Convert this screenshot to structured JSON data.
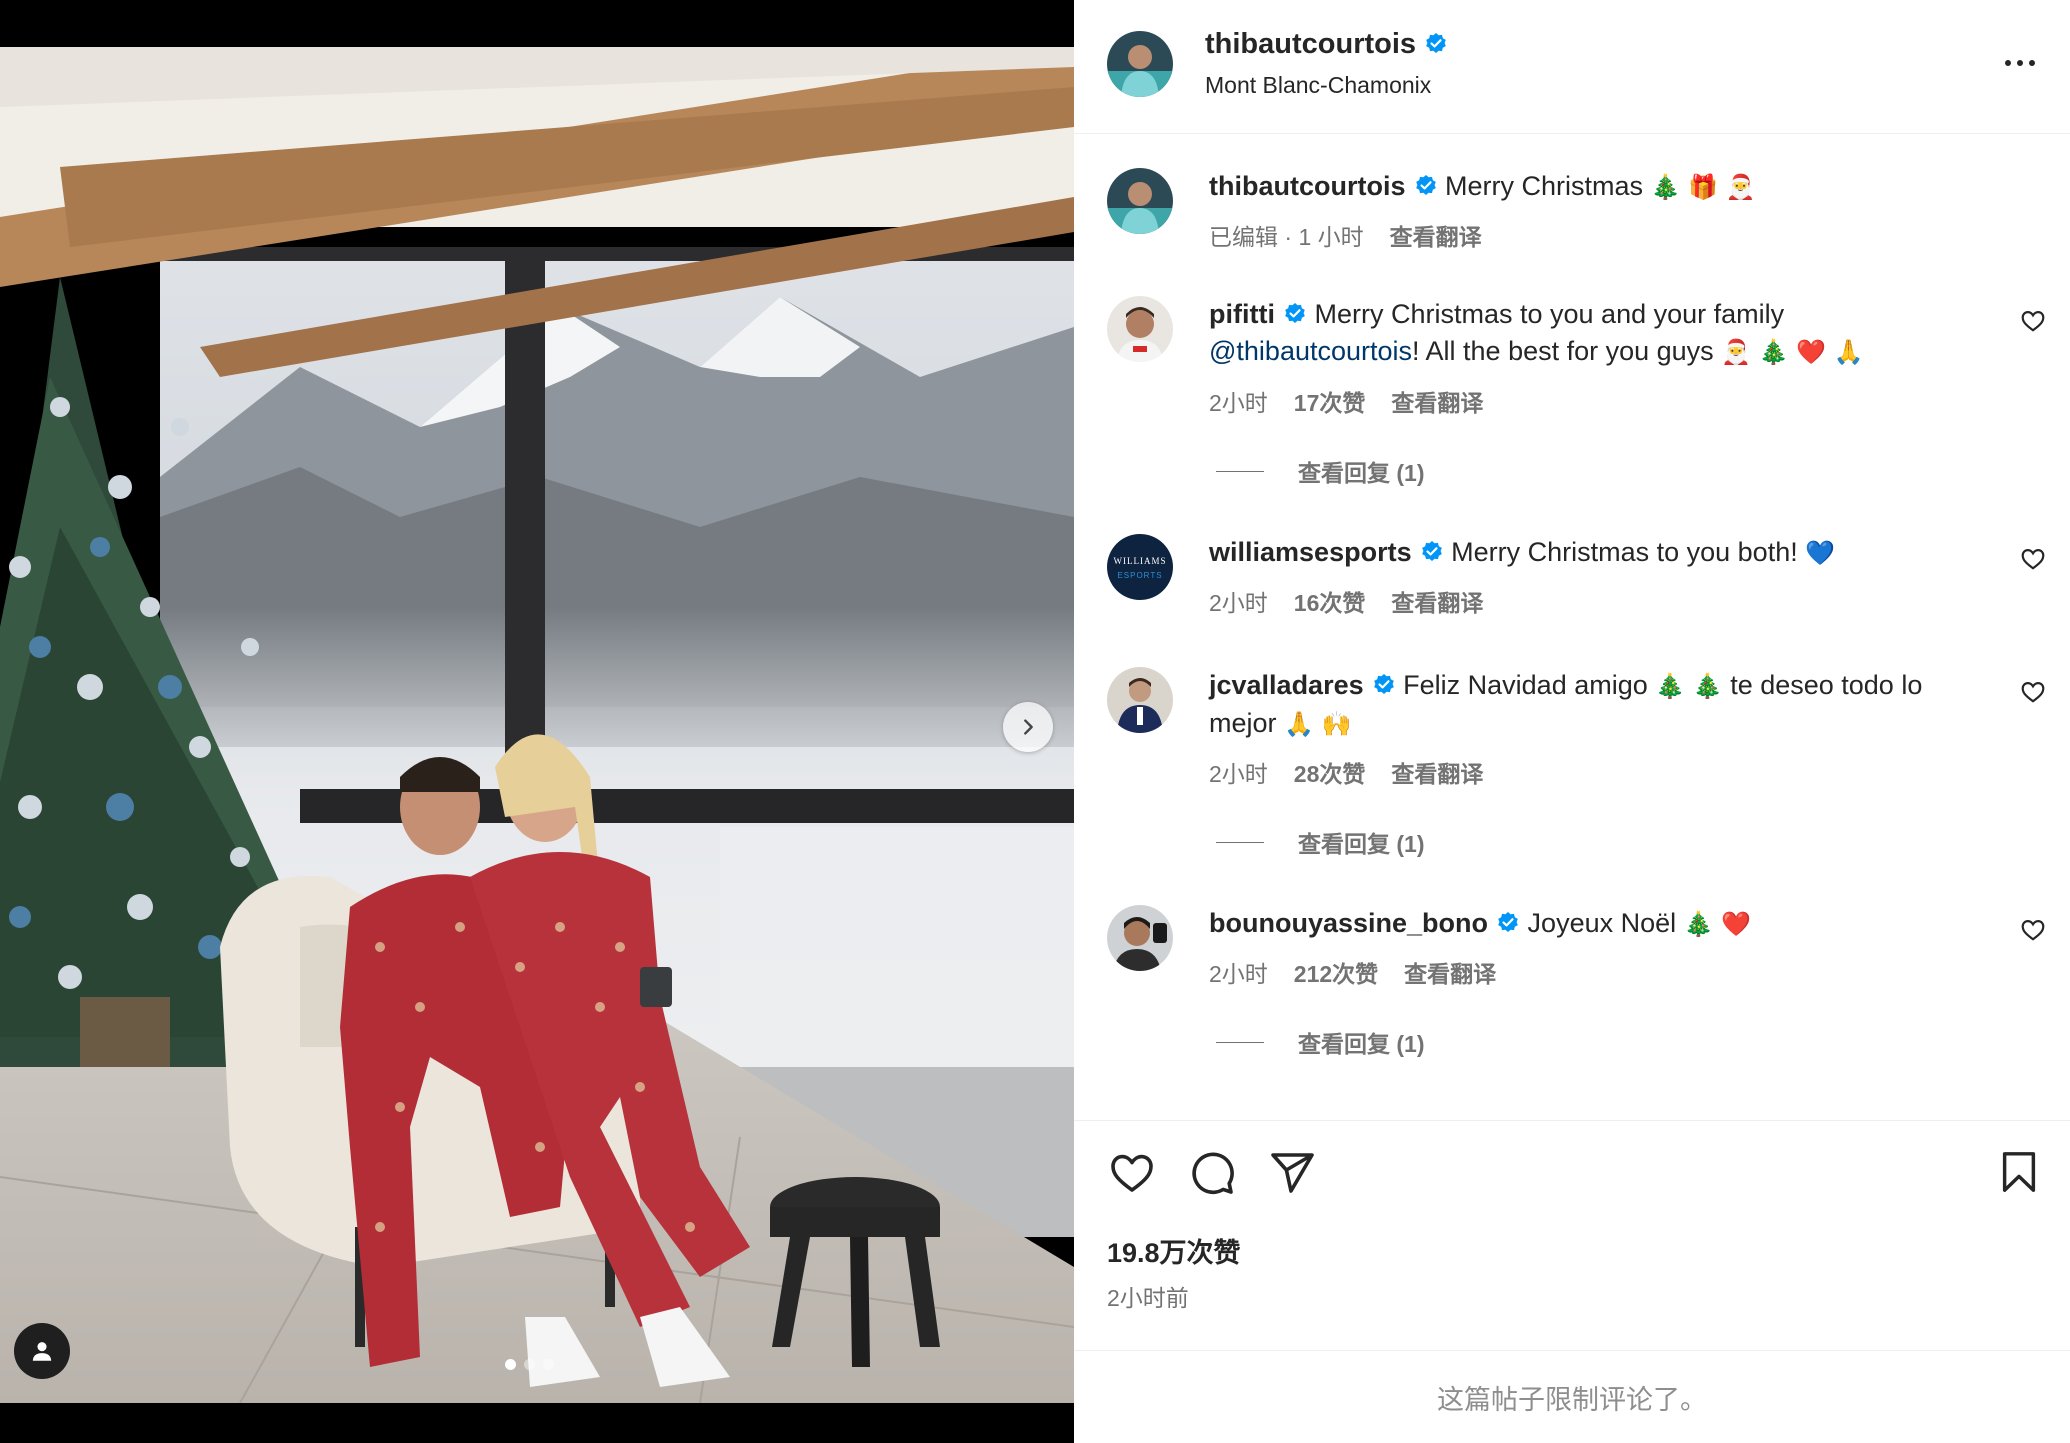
{
  "post": {
    "username": "thibautcourtois",
    "location": "Mont Blanc-Chamonix",
    "caption": "Merry Christmas",
    "caption_emojis": "🎄 🎁 🎅",
    "caption_meta": "已编辑 · 1 小时",
    "see_translation": "查看翻译",
    "likes": "19.8万次赞",
    "time_ago": "2小时前",
    "comments_limited": "这篇帖子限制评论了。"
  },
  "comments": [
    {
      "username": "pifitti",
      "text_1": "Merry Christmas to you and your family",
      "mention": "@thibautcourtois",
      "text_2": "! All the best for you guys",
      "emojis": "🎅 🎄 ❤️ 🙏",
      "time": "2小时",
      "likes": "17次赞",
      "translate": "查看翻译",
      "replies": "查看回复 (1)"
    },
    {
      "username": "williamsesports",
      "text": "Merry Christmas to you both!",
      "emojis": "💙",
      "time": "2小时",
      "likes": "16次赞",
      "translate": "查看翻译"
    },
    {
      "username": "jcvalladares",
      "text_1": "Feliz Navidad amigo",
      "emojis_1": "🎄 🎄",
      "text_2": "te deseo todo lo mejor",
      "emojis_2": "🙏 🙌",
      "time": "2小时",
      "likes": "28次赞",
      "translate": "查看翻译",
      "replies": "查看回复 (1)"
    },
    {
      "username": "bounouyassine_bono",
      "text": "Joyeux Noël",
      "emojis": "🎄 ❤️",
      "time": "2小时",
      "likes": "212次赞",
      "translate": "查看翻译",
      "replies": "查看回复 (1)"
    }
  ],
  "williams_logo": {
    "line1": "WILLIAMS",
    "line2": "ESPORTS"
  },
  "icons": {
    "header": [
      "verified-badge",
      "more-options-icon"
    ],
    "actions": [
      "like-heart-icon",
      "comment-icon",
      "share-icon",
      "save-bookmark-icon"
    ],
    "media": [
      "carousel-next-icon",
      "tagged-user-icon"
    ]
  },
  "colors": {
    "verified": "#0095f6",
    "text": "#262626",
    "secondary": "#737373",
    "red": "#e0102a"
  },
  "carousel": {
    "total": 3,
    "current": 1
  }
}
